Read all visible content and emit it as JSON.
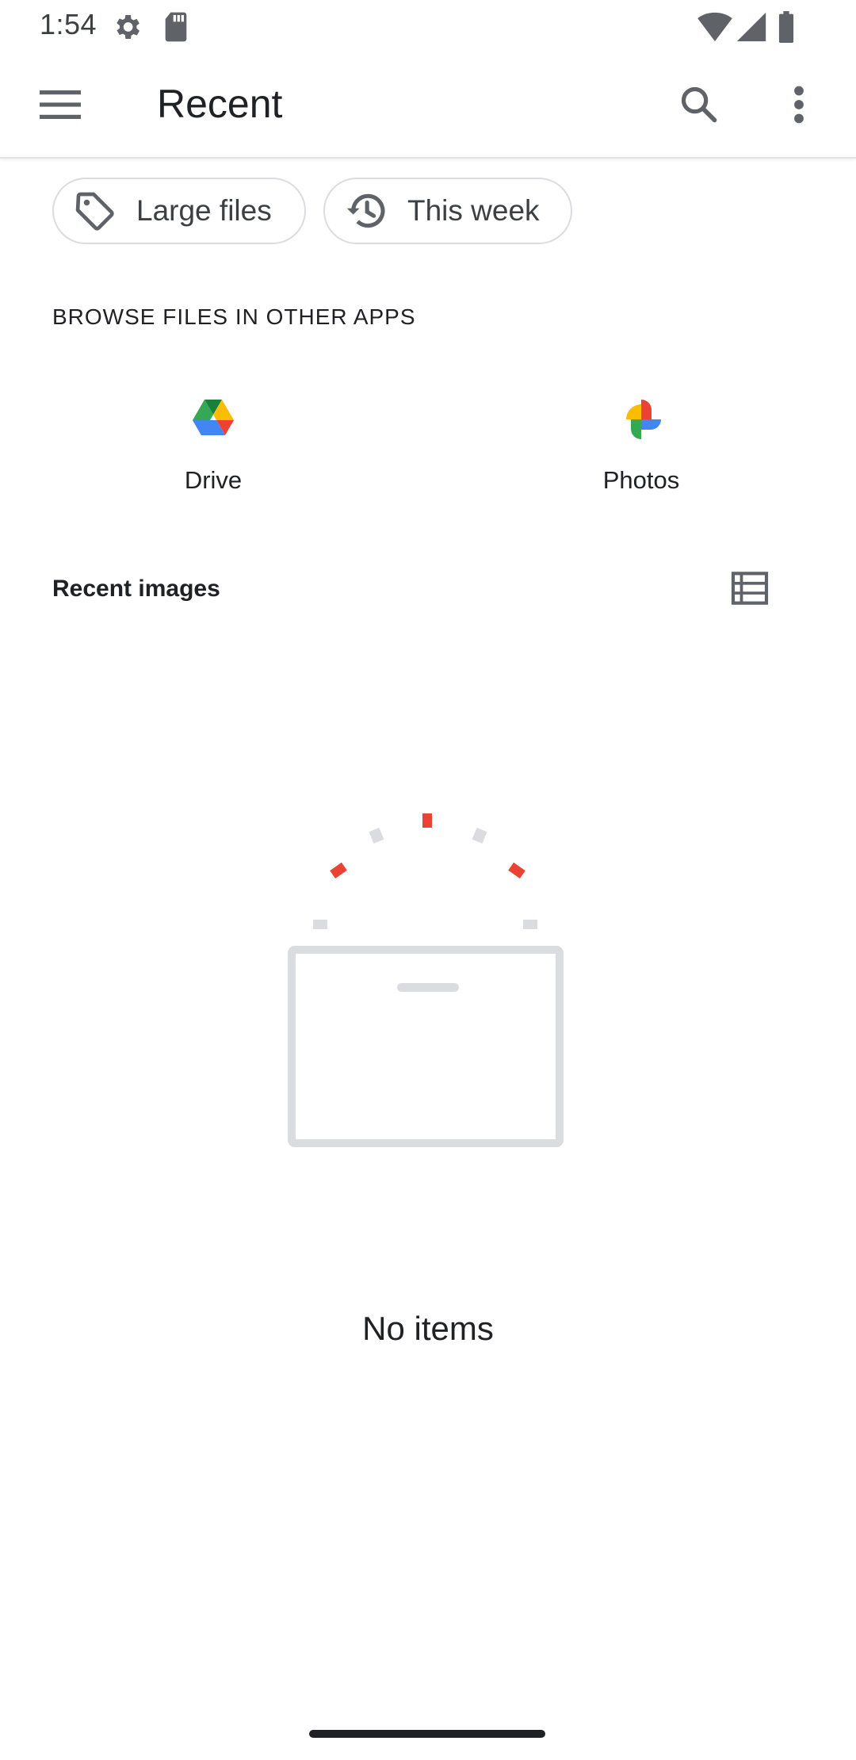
{
  "status_bar": {
    "time": "1:54"
  },
  "app_bar": {
    "title": "Recent"
  },
  "chips": [
    {
      "label": "Large files",
      "icon": "tag-icon"
    },
    {
      "label": "This week",
      "icon": "history-icon"
    }
  ],
  "browse_section": {
    "header": "BROWSE FILES IN OTHER APPS",
    "apps": [
      {
        "label": "Drive",
        "icon": "google-drive-icon"
      },
      {
        "label": "Photos",
        "icon": "google-photos-icon"
      }
    ]
  },
  "recent_images": {
    "header": "Recent images",
    "view_toggle_icon": "list-view-icon",
    "empty_message": "No items"
  },
  "colors": {
    "accent_red": "#ea4335",
    "illustration_gray": "#dadce0",
    "text_primary": "#202124"
  }
}
